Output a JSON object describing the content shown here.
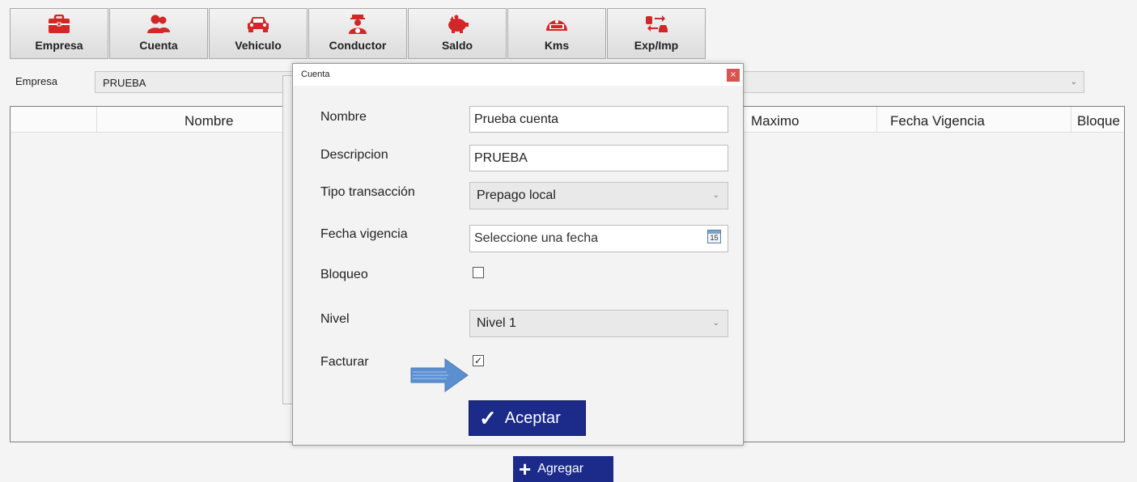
{
  "toolbar": {
    "items": [
      {
        "label": "Empresa",
        "icon": "briefcase-icon"
      },
      {
        "label": "Cuenta",
        "icon": "users-icon"
      },
      {
        "label": "Vehiculo",
        "icon": "car-icon"
      },
      {
        "label": "Conductor",
        "icon": "driver-icon"
      },
      {
        "label": "Saldo",
        "icon": "piggy-bank-icon"
      },
      {
        "label": "Kms",
        "icon": "speedometer-icon"
      },
      {
        "label": "Exp/Imp",
        "icon": "exchange-icon"
      }
    ]
  },
  "empresa": {
    "label": "Empresa",
    "value": "PRUEBA"
  },
  "grid": {
    "columns": [
      "Nombre",
      "Maximo",
      "Fecha Vigencia",
      "Bloque"
    ]
  },
  "dialog": {
    "title": "Cuenta",
    "close_label": "×",
    "fields": {
      "nombre": {
        "label": "Nombre",
        "value": "Prueba cuenta"
      },
      "descripcion": {
        "label": "Descripcion",
        "value": "PRUEBA"
      },
      "tipo": {
        "label": "Tipo transacción",
        "value": "Prepago local"
      },
      "fecha": {
        "label": "Fecha vigencia",
        "value": "Seleccione una fecha",
        "calendar_day": "15"
      },
      "bloqueo": {
        "label": "Bloqueo",
        "checked": false
      },
      "nivel": {
        "label": "Nivel",
        "value": "Nivel 1"
      },
      "facturar": {
        "label": "Facturar",
        "checked": true
      }
    },
    "accept_label": "Aceptar"
  },
  "add_label": "Agregar",
  "colors": {
    "accent_red": "#d32626",
    "button_navy": "#1c2a8a",
    "arrow_blue": "#5b8fd0"
  }
}
